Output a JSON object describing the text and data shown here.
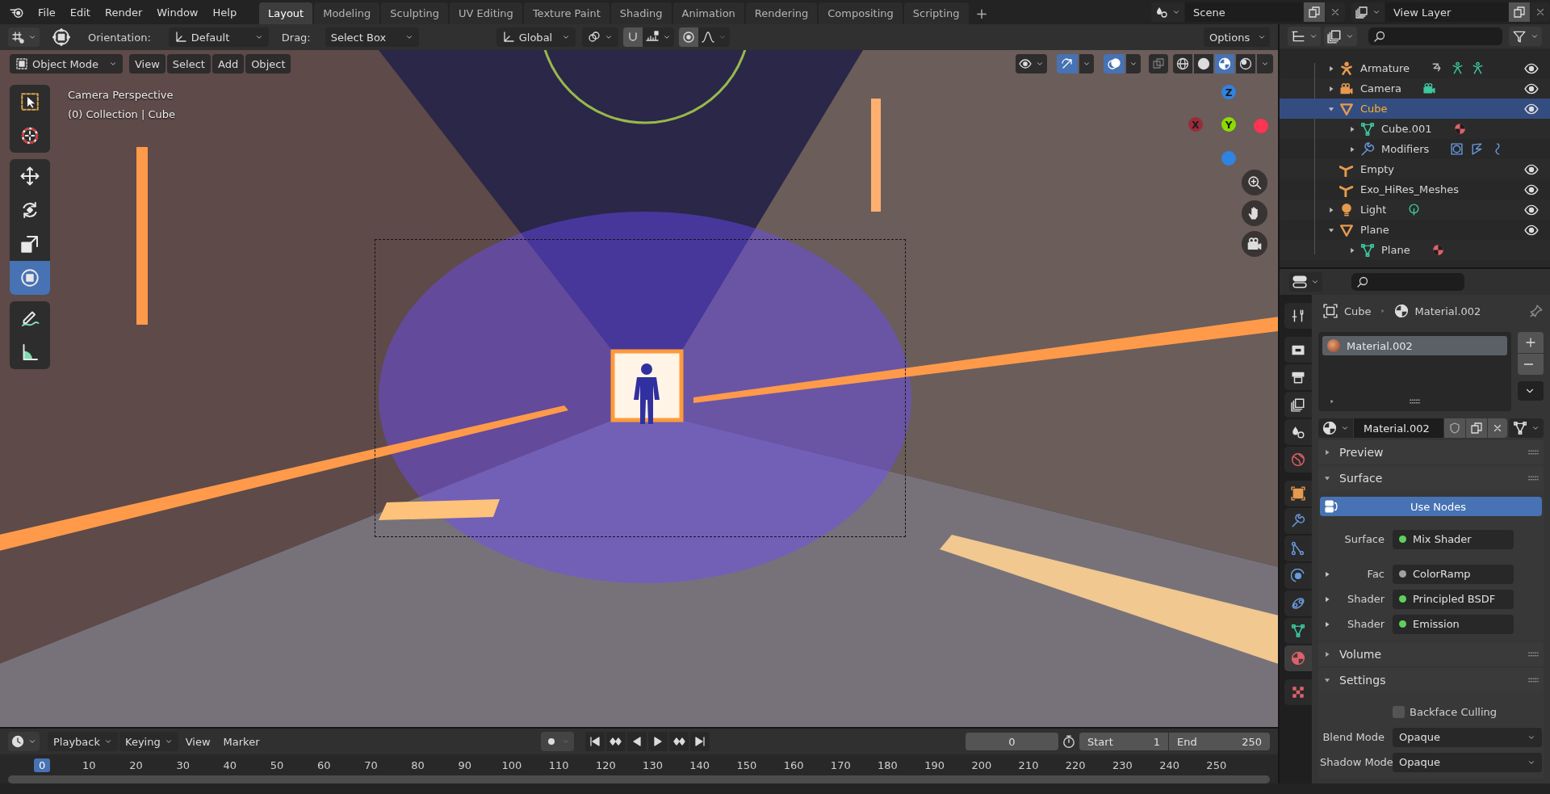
{
  "topbar": {
    "menus": [
      "File",
      "Edit",
      "Render",
      "Window",
      "Help"
    ],
    "workspaces": [
      {
        "label": "Layout",
        "selected": true
      },
      {
        "label": "Modeling",
        "selected": false
      },
      {
        "label": "Sculpting",
        "selected": false
      },
      {
        "label": "UV Editing",
        "selected": false
      },
      {
        "label": "Texture Paint",
        "selected": false
      },
      {
        "label": "Shading",
        "selected": false
      },
      {
        "label": "Animation",
        "selected": false
      },
      {
        "label": "Rendering",
        "selected": false
      },
      {
        "label": "Compositing",
        "selected": false
      },
      {
        "label": "Scripting",
        "selected": false
      }
    ],
    "add_button": "+",
    "scene": "Scene",
    "view_layer": "View Layer"
  },
  "tool_header": {
    "orientation_label": "Orientation:",
    "orientation": "Default",
    "drag_label": "Drag:",
    "drag": "Select Box",
    "transform_space": "Global",
    "options": "Options"
  },
  "viewport_header": {
    "mode": "Object Mode",
    "menus": [
      "View",
      "Select",
      "Add",
      "Object"
    ],
    "gizmos": true,
    "overlays": true,
    "xray": false,
    "shading": [
      {
        "kind": "wireframe",
        "selected": false
      },
      {
        "kind": "solid",
        "selected": false
      },
      {
        "kind": "material",
        "selected": true
      },
      {
        "kind": "rendered",
        "selected": false
      }
    ]
  },
  "viewport": {
    "info": [
      "Camera Perspective",
      "(0) Collection | Cube"
    ],
    "tools": [
      {
        "kind": "select_box",
        "selected": false
      },
      {
        "kind": "cursor",
        "selected": false
      },
      {
        "kind": "move",
        "selected": false
      },
      {
        "kind": "rotate",
        "selected": false
      },
      {
        "kind": "scale",
        "selected": false
      },
      {
        "kind": "transform",
        "selected": true
      },
      {
        "kind": "annotate",
        "selected": false
      },
      {
        "kind": "measure",
        "selected": false
      }
    ],
    "axes": [
      {
        "color": "#2f83e3"
      },
      {
        "color": "#ff3352"
      },
      {
        "label": "X",
        "color": "#9c2b3a"
      },
      {
        "label": "Z",
        "color": "#2f83e3"
      },
      {
        "label": "Y",
        "color": "#8bdc00"
      }
    ]
  },
  "outliner": {
    "items": [
      {
        "name": "Armature",
        "kind": "armature",
        "expanded": false,
        "selected": false,
        "visible": true,
        "data": [
          {
            "kind": "action"
          },
          {
            "kind": "pose"
          },
          {
            "kind": "pose"
          }
        ]
      },
      {
        "name": "Camera",
        "kind": "camera",
        "expanded": false,
        "selected": false,
        "visible": true,
        "data": [
          {
            "kind": "camera_data"
          }
        ]
      },
      {
        "name": "Cube",
        "kind": "mesh",
        "expanded": true,
        "selected": true,
        "visible": true,
        "children": [
          {
            "name": "Cube.001",
            "kind": "mesh_data",
            "expanded": false,
            "selected": false,
            "data": [
              {
                "kind": "material"
              }
            ]
          },
          {
            "name": "Modifiers",
            "kind": "modifiers",
            "expanded": false,
            "selected": false,
            "data": [
              {
                "kind": "mod_a"
              },
              {
                "kind": "mod_b"
              },
              {
                "kind": "mod_c"
              }
            ]
          }
        ]
      },
      {
        "name": "Empty",
        "kind": "empty",
        "selected": false,
        "visible": true
      },
      {
        "name": "Exo_HiRes_Meshes",
        "kind": "empty",
        "selected": false,
        "visible": true
      },
      {
        "name": "Light",
        "kind": "light",
        "expanded": false,
        "selected": false,
        "visible": true,
        "data": [
          {
            "kind": "light_data"
          }
        ]
      },
      {
        "name": "Plane",
        "kind": "mesh",
        "expanded": true,
        "selected": false,
        "visible": true,
        "children": [
          {
            "name": "Plane",
            "kind": "mesh_data",
            "expanded": false,
            "selected": false,
            "data": [
              {
                "kind": "material"
              }
            ]
          }
        ]
      }
    ]
  },
  "properties": {
    "tabs": [
      {
        "kind": "tool",
        "selected": false
      },
      {
        "kind": "render",
        "selected": false
      },
      {
        "kind": "output",
        "selected": false
      },
      {
        "kind": "view_layer",
        "selected": false
      },
      {
        "kind": "scene",
        "selected": false
      },
      {
        "kind": "world",
        "selected": false
      },
      {
        "kind": "object",
        "selected": false
      },
      {
        "kind": "modifiers",
        "selected": false
      },
      {
        "kind": "particles",
        "selected": false
      },
      {
        "kind": "physics",
        "selected": false
      },
      {
        "kind": "constraints",
        "selected": false
      },
      {
        "kind": "data",
        "selected": false
      },
      {
        "kind": "material",
        "selected": true
      },
      {
        "kind": "texture",
        "selected": false
      }
    ],
    "breadcrumb": [
      "Cube",
      "Material.002"
    ],
    "slots": [
      {
        "name": "Material.002",
        "selected": true
      }
    ],
    "material": "Material.002",
    "panels": [
      {
        "title": "Preview",
        "expanded": false
      },
      {
        "title": "Surface",
        "expanded": true,
        "kind": "surface",
        "use_nodes": {
          "label": "Use Nodes",
          "on": true
        },
        "sockets": [
          {
            "label": "Surface",
            "value": "Mix Shader",
            "color": "#5fcf5f"
          },
          {
            "label": "Fac",
            "value": "ColorRamp",
            "color": "#a1a1a1",
            "expanded": false
          },
          {
            "label": "Shader",
            "value": "Principled BSDF",
            "color": "#5fcf5f",
            "expanded": false
          },
          {
            "label": "Shader",
            "value": "Emission",
            "color": "#5fcf5f",
            "expanded": false
          }
        ]
      },
      {
        "title": "Volume",
        "expanded": false
      },
      {
        "title": "Settings",
        "expanded": true,
        "kind": "settings",
        "checkbox": {
          "label": "Backface Culling",
          "checked": false
        },
        "fields": [
          {
            "label": "Blend Mode",
            "value": "Opaque"
          },
          {
            "label": "Shadow Mode",
            "value": "Opaque"
          }
        ]
      }
    ]
  },
  "timeline": {
    "menus": [
      {
        "label": "Playback",
        "kind": "dropdown"
      },
      {
        "label": "Keying",
        "kind": "dropdown"
      },
      {
        "label": "View",
        "kind": "menu"
      },
      {
        "label": "Marker",
        "kind": "menu"
      }
    ],
    "current_frame": "0",
    "start_label": "Start",
    "start": "1",
    "end_label": "End",
    "end": "250",
    "frames": [
      {
        "label": "0",
        "selected": true
      },
      {
        "label": "10",
        "selected": false
      },
      {
        "label": "20",
        "selected": false
      },
      {
        "label": "30",
        "selected": false
      },
      {
        "label": "40",
        "selected": false
      },
      {
        "label": "50",
        "selected": false
      },
      {
        "label": "60",
        "selected": false
      },
      {
        "label": "70",
        "selected": false
      },
      {
        "label": "80",
        "selected": false
      },
      {
        "label": "90",
        "selected": false
      },
      {
        "label": "100",
        "selected": false
      },
      {
        "label": "110",
        "selected": false
      },
      {
        "label": "120",
        "selected": false
      },
      {
        "label": "130",
        "selected": false
      },
      {
        "label": "140",
        "selected": false
      },
      {
        "label": "150",
        "selected": false
      },
      {
        "label": "160",
        "selected": false
      },
      {
        "label": "170",
        "selected": false
      },
      {
        "label": "180",
        "selected": false
      },
      {
        "label": "190",
        "selected": false
      },
      {
        "label": "200",
        "selected": false
      },
      {
        "label": "210",
        "selected": false
      },
      {
        "label": "220",
        "selected": false
      },
      {
        "label": "230",
        "selected": false
      },
      {
        "label": "240",
        "selected": false
      },
      {
        "label": "250",
        "selected": false
      }
    ]
  }
}
